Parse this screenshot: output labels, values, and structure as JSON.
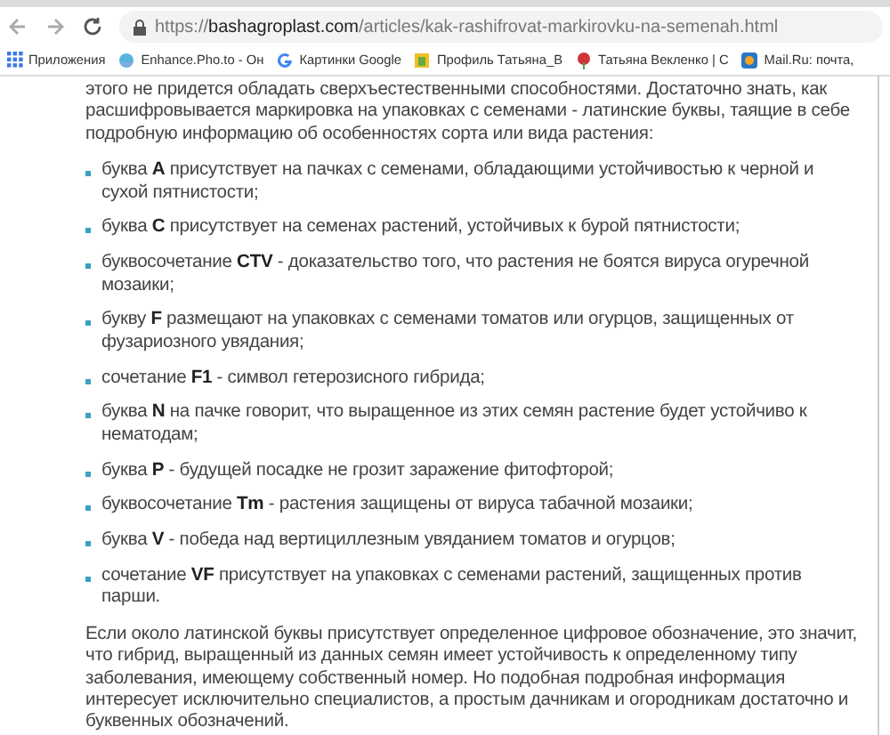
{
  "address_bar": {
    "scheme": "https://",
    "domain": "bashagroplast.com",
    "path": "/articles/kak-rashifrovat-markirovku-na-semenah.html"
  },
  "bookmarks": [
    {
      "kind": "apps",
      "label": "Приложения"
    },
    {
      "kind": "photo",
      "label": "Enhance.Pho.to - Он"
    },
    {
      "kind": "google",
      "label": "Картинки Google"
    },
    {
      "kind": "profile",
      "label": "Профиль Татьяна_В"
    },
    {
      "kind": "flower",
      "label": "Татьяна Векленко | С"
    },
    {
      "kind": "mail",
      "label": "Mail.Ru: почта,"
    }
  ],
  "intro": "этого не придется обладать сверхъестественными способностями. Достаточно знать, как расшифровывается маркировка на упаковках с семенами - латинские буквы, таящие в себе подробную информацию об особенностях сорта или вида растения:",
  "list": [
    "буква **A** присутствует на пачках с семенами, обладающими устойчивостью к черной и сухой пятнистости;",
    "буква **C** присутствует на семенах растений, устойчивых к бурой пятнистости;",
    "буквосочетание **CTV** - доказательство того, что растения не боятся вируса огуречной мозаики;",
    "букву **F** размещают на упаковках с семенами томатов или огурцов, защищенных от фузариозного увядания;",
    "сочетание **F1** - символ гетерозисного гибрида;",
    "буква **N** на пачке говорит, что выращенное из этих семян растение будет устойчиво к нематодам;",
    "буква **P** - будущей посадке не грозит заражение фитофторой;",
    "буквосочетание **Tm** - растения защищены от вируса табачной мозаики;",
    "буква **V** - победа над вертициллезным увяданием томатов и огурцов;",
    "сочетание **VF** присутствует на упаковках с семенами растений, защищенных против парши."
  ],
  "outro": "Если около латинской буквы присутствует определенное цифровое обозначение, это значит, что гибрид, выращенный из данных семян имеет устойчивость к определенному типу заболевания, имеющему собственный номер. Но подобная подробная информация интересует исключительно специалистов, а простым дачникам и огородникам достаточно и буквенных обозначений."
}
